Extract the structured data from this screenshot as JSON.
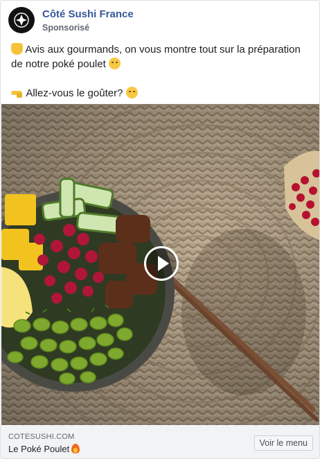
{
  "post": {
    "page_name": "Côté Sushi France",
    "sponsored_label": "Sponsorisé",
    "text_line1_a": "Avis aux gourmands, on vous montre tout sur la préparation",
    "text_line1_b": "de notre poké poulet",
    "text_line2": "Allez-vous le goûter?",
    "emoji_names": [
      "raising-hands-icon",
      "yum-face-icon",
      "pointing-hand-icon",
      "smirk-face-icon",
      "fire-icon"
    ]
  },
  "media": {
    "type": "video",
    "subject": "poke-bowl-video-thumbnail",
    "play_icon": "play-icon"
  },
  "footer": {
    "domain": "COTESUSHI.COM",
    "headline": "Le Poké Poulet",
    "cta_label": "Voir le menu"
  },
  "colors": {
    "page_name": "#385898",
    "meta_text": "#606770",
    "footer_bg": "#f2f3f5"
  }
}
